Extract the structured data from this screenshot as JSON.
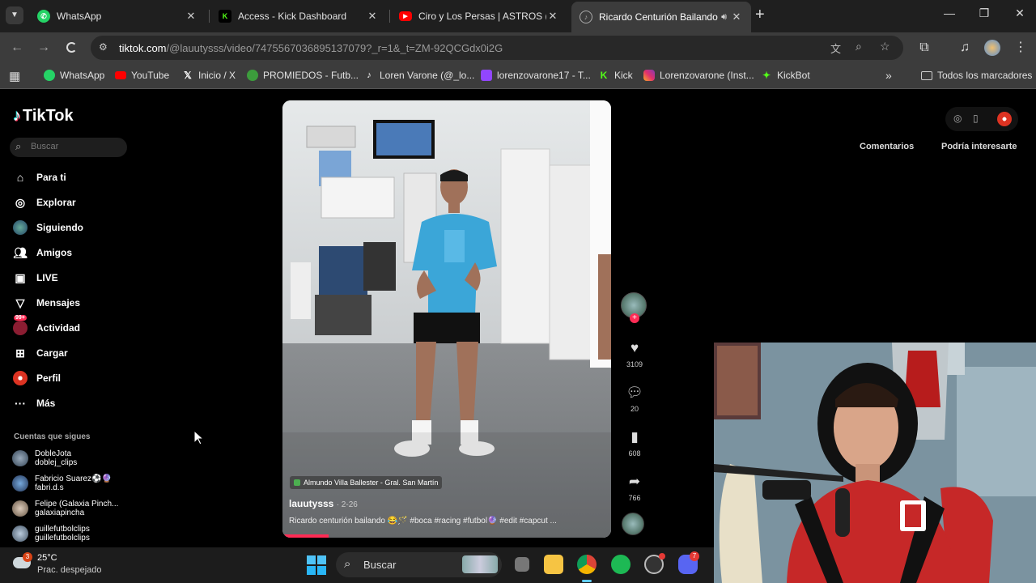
{
  "browser": {
    "tabs": [
      {
        "title": "WhatsApp",
        "icon": "whatsapp-icon",
        "color": "#25d366"
      },
      {
        "title": "Access - Kick Dashboard",
        "icon": "kick-icon",
        "color": "#53fc18"
      },
      {
        "title": "Ciro y Los Persas | ASTROS (Re",
        "icon": "youtube-icon",
        "color": "#ff0000"
      },
      {
        "title": "Ricardo Centurión Bailando",
        "icon": "tiktok-icon",
        "color": "#aaaaaa"
      }
    ],
    "url_host": "tiktok.com",
    "url_path": "/@lauutysss/video/7475567036895137079?_r=1&_t=ZM-92QCGdx0i2G",
    "bookmarks": [
      {
        "label": "WhatsApp",
        "icon": "whatsapp-icon",
        "color": "#25d366"
      },
      {
        "label": "YouTube",
        "icon": "youtube-icon",
        "color": "#ff0000"
      },
      {
        "label": "Inicio / X",
        "icon": "x-icon",
        "color": "#ffffff"
      },
      {
        "label": "PROMIEDOS - Futb...",
        "icon": "promiedos-icon",
        "color": "#3c9c3c"
      },
      {
        "label": "Loren Varone (@_lo...",
        "icon": "tiktok-icon",
        "color": "#ffffff"
      },
      {
        "label": "lorenzovarone17 - T...",
        "icon": "twitch-icon",
        "color": "#9146ff"
      },
      {
        "label": "Kick",
        "icon": "kick-icon",
        "color": "#53fc18"
      },
      {
        "label": "Lorenzovarone (Inst...",
        "icon": "instagram-icon",
        "color": "#e1306c"
      },
      {
        "label": "KickBot",
        "icon": "kickbot-icon",
        "color": "#53fc18"
      }
    ],
    "all_bookmarks": "Todos los marcadores"
  },
  "tiktok": {
    "logo": "TikTok",
    "search_placeholder": "Buscar",
    "nav": [
      {
        "label": "Para ti",
        "icon": "home-icon"
      },
      {
        "label": "Explorar",
        "icon": "compass-icon"
      },
      {
        "label": "Siguiendo",
        "icon": "following-icon"
      },
      {
        "label": "Amigos",
        "icon": "friends-icon"
      },
      {
        "label": "LIVE",
        "icon": "live-icon"
      },
      {
        "label": "Mensajes",
        "icon": "messages-icon"
      },
      {
        "label": "Actividad",
        "icon": "activity-icon",
        "badge": "99+"
      },
      {
        "label": "Cargar",
        "icon": "upload-icon"
      },
      {
        "label": "Perfil",
        "icon": "profile-icon"
      },
      {
        "label": "Más",
        "icon": "more-icon"
      }
    ],
    "following_heading": "Cuentas que sigues",
    "accounts": [
      {
        "name": "DobleJota",
        "handle": "doblej_clips"
      },
      {
        "name": "Fabricio Suarez⚽🔮",
        "handle": "fabri.d.s"
      },
      {
        "name": "Felipe (Galaxia Pinch...",
        "handle": "galaxiapincha"
      },
      {
        "name": "guillefutbolclips",
        "handle": "guillefutbolclips"
      }
    ],
    "video": {
      "location": "Almundo Villa Ballester - Gral. San Martín",
      "author": "lauutysss",
      "date": "· 2-26",
      "caption": "Ricardo centurión bailando 😂🪄 #boca #racing #futbol🔮 #edit #capcut ...",
      "progress": 0.14
    },
    "actions": [
      {
        "icon": "heart-icon",
        "count": "3109"
      },
      {
        "icon": "comment-icon",
        "count": "20"
      },
      {
        "icon": "bookmark-icon",
        "count": "608"
      },
      {
        "icon": "share-icon",
        "count": "766"
      }
    ],
    "right_tabs": [
      "Comentarios",
      "Podría interesarte"
    ]
  },
  "taskbar": {
    "weather_temp": "25°C",
    "weather_desc": "Prac. despejado",
    "weather_badge": "3",
    "search_label": "Buscar",
    "discord_badge": "7"
  }
}
